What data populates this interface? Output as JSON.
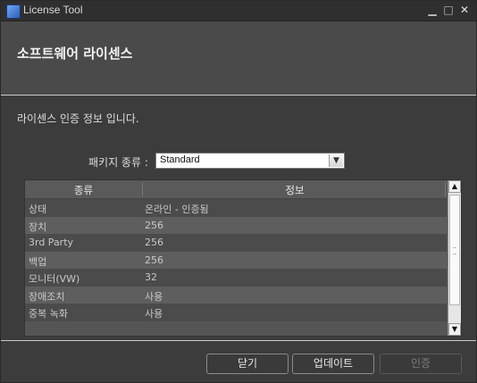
{
  "window": {
    "title": "License Tool",
    "controls": {
      "minimize": "▁",
      "maximize": "□",
      "close": "✕"
    }
  },
  "header": {
    "heading": "소프트웨어 라이센스"
  },
  "description": "라이센스 인증 정보 입니다.",
  "package": {
    "label": "패키지 종류 :",
    "selected": "Standard"
  },
  "table": {
    "columns": [
      "종류",
      "정보"
    ],
    "rows": [
      [
        "상태",
        "온라인 - 인증됨"
      ],
      [
        "장치",
        "256"
      ],
      [
        "3rd Party",
        "256"
      ],
      [
        "백업",
        "256"
      ],
      [
        "모니터(VW)",
        "32"
      ],
      [
        "장애조치",
        "사용"
      ],
      [
        "중복 녹화",
        "사용"
      ]
    ]
  },
  "buttons": {
    "close": "닫기",
    "update": "업데이트",
    "authenticate": "인증"
  }
}
